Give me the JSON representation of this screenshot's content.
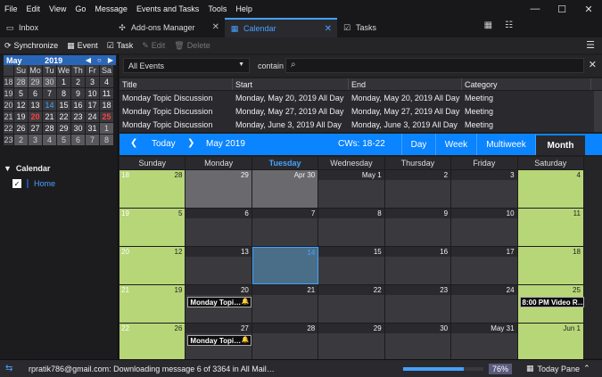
{
  "menu": [
    "File",
    "Edit",
    "View",
    "Go",
    "Message",
    "Events and Tasks",
    "Tools",
    "Help"
  ],
  "window_controls": {
    "minimize": "—",
    "maximize": "☐",
    "close": "✕"
  },
  "tabs": [
    {
      "label": "Inbox",
      "icon": "inbox-icon",
      "active": false
    },
    {
      "label": "Add-ons Manager",
      "icon": "puzzle-icon",
      "active": false
    },
    {
      "label": "Calendar",
      "icon": "calendar-icon",
      "active": true
    },
    {
      "label": "Tasks",
      "icon": "tasks-icon",
      "active": false
    }
  ],
  "toolbar": {
    "sync": "Synchronize",
    "event": "Event",
    "task": "Task",
    "edit": "Edit",
    "delete": "Delete"
  },
  "minical": {
    "month": "May",
    "year": "2019",
    "day_headers": [
      "Su",
      "Mo",
      "Tu",
      "We",
      "Th",
      "Fr",
      "Sa"
    ],
    "weeks": [
      {
        "wk": "18",
        "days": [
          "28",
          "29",
          "30",
          "1",
          "2",
          "3",
          "4"
        ],
        "other": [
          1,
          1,
          1,
          0,
          0,
          0,
          0
        ]
      },
      {
        "wk": "19",
        "days": [
          "5",
          "6",
          "7",
          "8",
          "9",
          "10",
          "11"
        ],
        "other": [
          0,
          0,
          0,
          0,
          0,
          0,
          0
        ]
      },
      {
        "wk": "20",
        "days": [
          "12",
          "13",
          "14",
          "15",
          "16",
          "17",
          "18"
        ],
        "other": [
          0,
          0,
          0,
          0,
          0,
          0,
          0
        ]
      },
      {
        "wk": "21",
        "days": [
          "19",
          "20",
          "21",
          "22",
          "23",
          "24",
          "25"
        ],
        "other": [
          0,
          0,
          0,
          0,
          0,
          0,
          0
        ]
      },
      {
        "wk": "22",
        "days": [
          "26",
          "27",
          "28",
          "29",
          "30",
          "31",
          "1"
        ],
        "other": [
          0,
          0,
          0,
          0,
          0,
          0,
          1
        ]
      },
      {
        "wk": "23",
        "days": [
          "2",
          "3",
          "4",
          "5",
          "6",
          "7",
          "8"
        ],
        "other": [
          1,
          1,
          1,
          1,
          1,
          1,
          1
        ]
      }
    ]
  },
  "calendars": {
    "header": "Calendar",
    "items": [
      {
        "name": "Home",
        "checked": true
      }
    ]
  },
  "search": {
    "filter": "All Events",
    "contain": "contain",
    "query": ""
  },
  "event_list": {
    "columns": [
      "Title",
      "Start",
      "End",
      "Category"
    ],
    "rows": [
      [
        "Monday Topic Discussion",
        "Monday, May 20, 2019 All Day",
        "Monday, May 20, 2019 All Day",
        "Meeting"
      ],
      [
        "Monday Topic Discussion",
        "Monday, May 27, 2019 All Day",
        "Monday, May 27, 2019 All Day",
        "Meeting"
      ],
      [
        "Monday Topic Discussion",
        "Monday, June 3, 2019 All Day",
        "Monday, June 3, 2019 All Day",
        "Meeting"
      ]
    ]
  },
  "nav": {
    "today": "Today",
    "month_label": "May 2019",
    "cws": "CWs: 18-22",
    "views": [
      "Day",
      "Week",
      "Multiweek",
      "Month"
    ],
    "active_view": "Month"
  },
  "month_view": {
    "day_headers": [
      "Sunday",
      "Monday",
      "Tuesday",
      "Wednesday",
      "Thursday",
      "Friday",
      "Saturday"
    ],
    "today_col": 2,
    "weeks": [
      {
        "wk": "18",
        "days": [
          "28",
          "29",
          "Apr 30",
          "May 1",
          "2",
          "3",
          "4"
        ],
        "other": [
          1,
          1,
          1,
          0,
          0,
          0,
          0
        ],
        "events": {}
      },
      {
        "wk": "19",
        "days": [
          "5",
          "6",
          "7",
          "8",
          "9",
          "10",
          "11"
        ],
        "other": [
          0,
          0,
          0,
          0,
          0,
          0,
          0
        ],
        "events": {}
      },
      {
        "wk": "20",
        "days": [
          "12",
          "13",
          "14",
          "15",
          "16",
          "17",
          "18"
        ],
        "other": [
          0,
          0,
          0,
          0,
          0,
          0,
          0
        ],
        "events": {}
      },
      {
        "wk": "21",
        "days": [
          "19",
          "20",
          "21",
          "22",
          "23",
          "24",
          "25"
        ],
        "other": [
          0,
          0,
          0,
          0,
          0,
          0,
          0
        ],
        "events": {
          "1": "Monday Topi…",
          "6": "8:00 PM Video R…"
        }
      },
      {
        "wk": "22",
        "days": [
          "26",
          "27",
          "28",
          "29",
          "30",
          "May 31",
          "Jun 1"
        ],
        "other": [
          0,
          0,
          0,
          0,
          0,
          0,
          1
        ],
        "events": {
          "1": "Monday Topi…"
        }
      }
    ]
  },
  "status": {
    "text": "rpratik786@gmail.com: Downloading message 6 of 3364 in All Mail…",
    "progress_pct": 76,
    "progress_label": "76%",
    "today_pane": "Today Pane"
  },
  "colors": {
    "accent": "#0a84ff",
    "weekend": "#b7d678",
    "today_red": "#ff4040"
  }
}
